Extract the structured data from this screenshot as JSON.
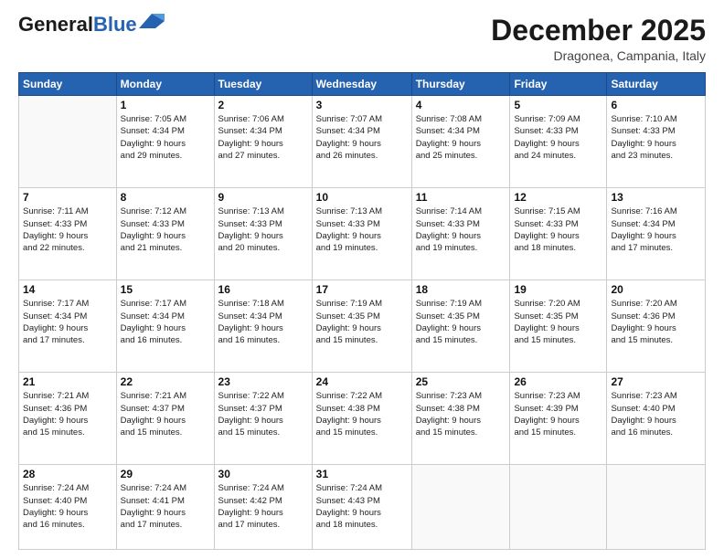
{
  "header": {
    "logo_line1": "General",
    "logo_line2": "Blue",
    "month_title": "December 2025",
    "location": "Dragonea, Campania, Italy"
  },
  "weekdays": [
    "Sunday",
    "Monday",
    "Tuesday",
    "Wednesday",
    "Thursday",
    "Friday",
    "Saturday"
  ],
  "weeks": [
    [
      null,
      {
        "day": "1",
        "sunrise": "7:05 AM",
        "sunset": "4:34 PM",
        "daylight": "9 hours and 29 minutes."
      },
      {
        "day": "2",
        "sunrise": "7:06 AM",
        "sunset": "4:34 PM",
        "daylight": "9 hours and 27 minutes."
      },
      {
        "day": "3",
        "sunrise": "7:07 AM",
        "sunset": "4:34 PM",
        "daylight": "9 hours and 26 minutes."
      },
      {
        "day": "4",
        "sunrise": "7:08 AM",
        "sunset": "4:34 PM",
        "daylight": "9 hours and 25 minutes."
      },
      {
        "day": "5",
        "sunrise": "7:09 AM",
        "sunset": "4:33 PM",
        "daylight": "9 hours and 24 minutes."
      },
      {
        "day": "6",
        "sunrise": "7:10 AM",
        "sunset": "4:33 PM",
        "daylight": "9 hours and 23 minutes."
      }
    ],
    [
      {
        "day": "7",
        "sunrise": "7:11 AM",
        "sunset": "4:33 PM",
        "daylight": "9 hours and 22 minutes."
      },
      {
        "day": "8",
        "sunrise": "7:12 AM",
        "sunset": "4:33 PM",
        "daylight": "9 hours and 21 minutes."
      },
      {
        "day": "9",
        "sunrise": "7:13 AM",
        "sunset": "4:33 PM",
        "daylight": "9 hours and 20 minutes."
      },
      {
        "day": "10",
        "sunrise": "7:13 AM",
        "sunset": "4:33 PM",
        "daylight": "9 hours and 19 minutes."
      },
      {
        "day": "11",
        "sunrise": "7:14 AM",
        "sunset": "4:33 PM",
        "daylight": "9 hours and 19 minutes."
      },
      {
        "day": "12",
        "sunrise": "7:15 AM",
        "sunset": "4:33 PM",
        "daylight": "9 hours and 18 minutes."
      },
      {
        "day": "13",
        "sunrise": "7:16 AM",
        "sunset": "4:34 PM",
        "daylight": "9 hours and 17 minutes."
      }
    ],
    [
      {
        "day": "14",
        "sunrise": "7:17 AM",
        "sunset": "4:34 PM",
        "daylight": "9 hours and 17 minutes."
      },
      {
        "day": "15",
        "sunrise": "7:17 AM",
        "sunset": "4:34 PM",
        "daylight": "9 hours and 16 minutes."
      },
      {
        "day": "16",
        "sunrise": "7:18 AM",
        "sunset": "4:34 PM",
        "daylight": "9 hours and 16 minutes."
      },
      {
        "day": "17",
        "sunrise": "7:19 AM",
        "sunset": "4:35 PM",
        "daylight": "9 hours and 15 minutes."
      },
      {
        "day": "18",
        "sunrise": "7:19 AM",
        "sunset": "4:35 PM",
        "daylight": "9 hours and 15 minutes."
      },
      {
        "day": "19",
        "sunrise": "7:20 AM",
        "sunset": "4:35 PM",
        "daylight": "9 hours and 15 minutes."
      },
      {
        "day": "20",
        "sunrise": "7:20 AM",
        "sunset": "4:36 PM",
        "daylight": "9 hours and 15 minutes."
      }
    ],
    [
      {
        "day": "21",
        "sunrise": "7:21 AM",
        "sunset": "4:36 PM",
        "daylight": "9 hours and 15 minutes."
      },
      {
        "day": "22",
        "sunrise": "7:21 AM",
        "sunset": "4:37 PM",
        "daylight": "9 hours and 15 minutes."
      },
      {
        "day": "23",
        "sunrise": "7:22 AM",
        "sunset": "4:37 PM",
        "daylight": "9 hours and 15 minutes."
      },
      {
        "day": "24",
        "sunrise": "7:22 AM",
        "sunset": "4:38 PM",
        "daylight": "9 hours and 15 minutes."
      },
      {
        "day": "25",
        "sunrise": "7:23 AM",
        "sunset": "4:38 PM",
        "daylight": "9 hours and 15 minutes."
      },
      {
        "day": "26",
        "sunrise": "7:23 AM",
        "sunset": "4:39 PM",
        "daylight": "9 hours and 15 minutes."
      },
      {
        "day": "27",
        "sunrise": "7:23 AM",
        "sunset": "4:40 PM",
        "daylight": "9 hours and 16 minutes."
      }
    ],
    [
      {
        "day": "28",
        "sunrise": "7:24 AM",
        "sunset": "4:40 PM",
        "daylight": "9 hours and 16 minutes."
      },
      {
        "day": "29",
        "sunrise": "7:24 AM",
        "sunset": "4:41 PM",
        "daylight": "9 hours and 17 minutes."
      },
      {
        "day": "30",
        "sunrise": "7:24 AM",
        "sunset": "4:42 PM",
        "daylight": "9 hours and 17 minutes."
      },
      {
        "day": "31",
        "sunrise": "7:24 AM",
        "sunset": "4:43 PM",
        "daylight": "9 hours and 18 minutes."
      },
      null,
      null,
      null
    ]
  ],
  "labels": {
    "sunrise": "Sunrise:",
    "sunset": "Sunset:",
    "daylight": "Daylight:"
  }
}
